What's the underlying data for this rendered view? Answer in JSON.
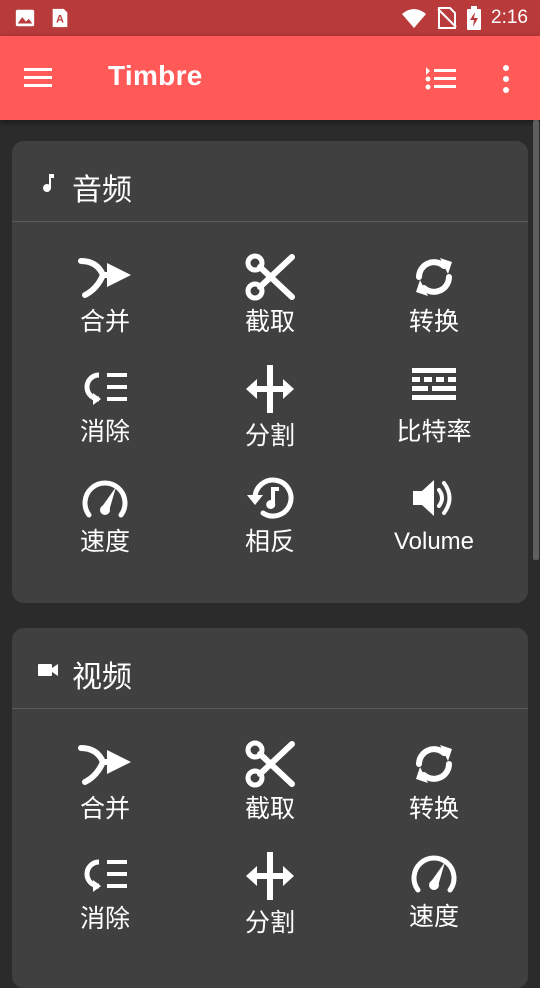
{
  "status_bar": {
    "time": "2:16",
    "icons": [
      "image-notification-icon",
      "text-notification-icon",
      "wifi-icon",
      "no-sim-icon",
      "battery-charging-icon"
    ]
  },
  "app_bar": {
    "title": "Timbre",
    "icons": [
      "hamburger-menu-icon",
      "list-icon",
      "more-vert-icon"
    ]
  },
  "colors": {
    "status_bar": "#b93a3a",
    "app_bar": "#ff5a58",
    "background": "#2b2b2b",
    "card": "#404040",
    "text": "#ffffff"
  },
  "audio_section": {
    "title": "音频",
    "icon": "music-note-icon",
    "tools": [
      {
        "label": "合并",
        "icon": "merge-icon"
      },
      {
        "label": "截取",
        "icon": "scissors-icon"
      },
      {
        "label": "转换",
        "icon": "convert-icon"
      },
      {
        "label": "消除",
        "icon": "remove-icon"
      },
      {
        "label": "分割",
        "icon": "split-icon"
      },
      {
        "label": "比特率",
        "icon": "bitrate-icon"
      },
      {
        "label": "速度",
        "icon": "speed-icon"
      },
      {
        "label": "相反",
        "icon": "reverse-icon"
      },
      {
        "label": "Volume",
        "icon": "volume-icon"
      }
    ]
  },
  "video_section": {
    "title": "视频",
    "icon": "video-camera-icon",
    "tools": [
      {
        "label": "合并",
        "icon": "merge-icon"
      },
      {
        "label": "截取",
        "icon": "scissors-icon"
      },
      {
        "label": "转换",
        "icon": "convert-icon"
      },
      {
        "label": "消除",
        "icon": "remove-icon"
      },
      {
        "label": "分割",
        "icon": "split-icon"
      },
      {
        "label": "速度",
        "icon": "speed-icon"
      }
    ]
  }
}
